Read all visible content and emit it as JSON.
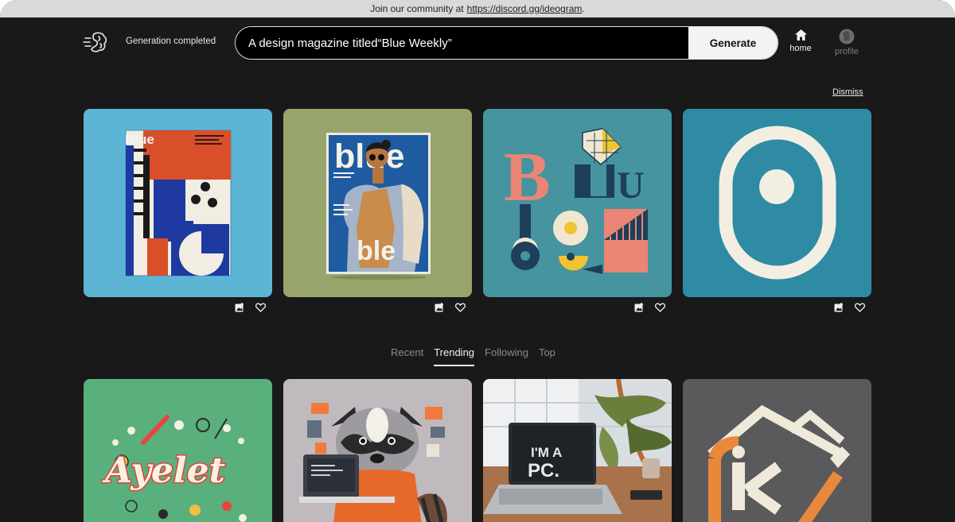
{
  "banner": {
    "text": "Join our community at",
    "link": "https://discord.gg/ideogram",
    "suffix": "."
  },
  "header": {
    "status": "Generation completed",
    "prompt_value": "A design magazine titled“Blue Weekly”",
    "generate_label": "Generate",
    "nav": [
      {
        "label": "home",
        "icon": "home-icon"
      },
      {
        "label": "profile",
        "icon": "profile-icon"
      }
    ]
  },
  "results": {
    "dismiss_label": "Dismiss",
    "images": [
      {
        "name": "result-image-1",
        "background": "#5db5d6",
        "text": "Blue"
      },
      {
        "name": "result-image-2",
        "background": "#97a56c",
        "text": "blue"
      },
      {
        "name": "result-image-3",
        "background": "#45949f",
        "text": "BLU"
      },
      {
        "name": "result-image-4",
        "background": "#2f8aa4",
        "text": ""
      }
    ],
    "image_texts": [
      "Blue",
      "blue",
      "ble",
      "B",
      "U"
    ]
  },
  "feed": {
    "tabs": [
      {
        "label": "Recent",
        "active": false
      },
      {
        "label": "Trending",
        "active": true
      },
      {
        "label": "Following",
        "active": false
      },
      {
        "label": "Top",
        "active": false
      }
    ],
    "images": [
      {
        "name": "feed-image-1",
        "background": "#59b07c",
        "text": "Ayelet"
      },
      {
        "name": "feed-image-2",
        "background": "#c0b9bd",
        "text": ""
      },
      {
        "name": "feed-image-3",
        "background": "#8a6e58",
        "text": "I'M A PC."
      },
      {
        "name": "feed-image-4",
        "background": "#5a5a5c",
        "text": ""
      }
    ],
    "image_texts": [
      "Ayelet",
      "I'M A",
      "PC."
    ]
  },
  "colors": {
    "background": "#191919",
    "banner": "#d9d9d9",
    "accent": "#f3f3f3"
  }
}
